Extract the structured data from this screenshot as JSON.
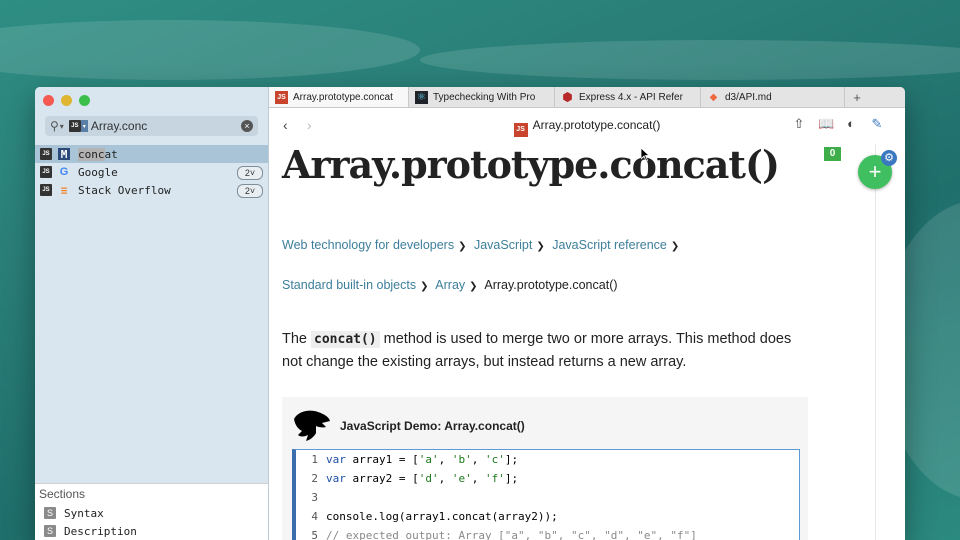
{
  "sidebar": {
    "search": {
      "value": "Array.conc",
      "placeholder": ""
    },
    "results": [
      {
        "source": "MDN",
        "label": "concat",
        "match": "conc",
        "rest": "at",
        "count": ""
      },
      {
        "source": "Google",
        "label": "Google",
        "count": "2"
      },
      {
        "source": "Stack Overflow",
        "label": "Stack Overflow",
        "count": "2"
      }
    ],
    "sections": {
      "title": "Sections",
      "items": [
        "Syntax",
        "Description"
      ]
    }
  },
  "tabs": [
    {
      "label": "Array.prototype.concat",
      "icon": "JS",
      "active": true
    },
    {
      "label": "Typechecking With Pro",
      "icon": "react-icon"
    },
    {
      "label": "Express 4.x - API Refer",
      "icon": "express-icon"
    },
    {
      "label": "d3/API.md",
      "icon": "d3-icon"
    }
  ],
  "tab_add": "+",
  "toolbar": {
    "back": "‹",
    "forward": "›",
    "title": "Array.prototype.concat()",
    "title_icon": "JS"
  },
  "badge_count": "0",
  "page": {
    "title": "Array.prototype.concat()",
    "breadcrumb1": [
      "Web technology for developers",
      "JavaScript",
      "JavaScript reference"
    ],
    "breadcrumb2": [
      "Standard built-in objects",
      "Array"
    ],
    "breadcrumb_current": "Array.prototype.concat()",
    "intro_before": "The ",
    "intro_code": "concat()",
    "intro_after": " method is used to merge two or more arrays. This method does not change the existing arrays, but instead returns a new array.",
    "demo_title": "JavaScript Demo: Array.concat()",
    "code": [
      {
        "n": "1",
        "kw": "var",
        "text": " array1 = [",
        "s1": "'a'",
        "c1": ", ",
        "s2": "'b'",
        "c2": ", ",
        "s3": "'c'",
        "end": "];"
      },
      {
        "n": "2",
        "kw": "var",
        "text": " array2 = [",
        "s1": "'d'",
        "c1": ", ",
        "s2": "'e'",
        "c2": ", ",
        "s3": "'f'",
        "end": "];"
      },
      {
        "n": "3",
        "plain": ""
      },
      {
        "n": "4",
        "plain": "console.log(array1.concat(array2));"
      },
      {
        "n": "5",
        "comment": "// expected output: Array [\"a\", \"b\", \"c\", \"d\", \"e\", \"f\"]"
      }
    ]
  },
  "colors": {
    "link": "#3d7e9a",
    "mdn_red": "#c8442c",
    "fab_green": "#3fbf5f"
  }
}
